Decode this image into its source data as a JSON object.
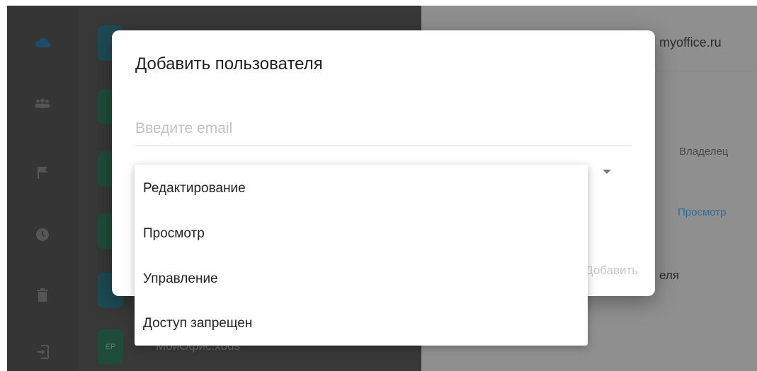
{
  "dialog": {
    "title": "Добавить пользователя",
    "email_placeholder": "Введите email",
    "add_label": "Добавить"
  },
  "permission_menu": {
    "items": [
      {
        "label": "Редактирование"
      },
      {
        "label": "Просмотр"
      },
      {
        "label": "Управление"
      },
      {
        "label": "Доступ запрещен"
      }
    ]
  },
  "info_pane": {
    "email_partial": "myoffice.ru",
    "owner_role": "Владелец",
    "view_role": "Просмотр",
    "trailing_text": "еля"
  },
  "file_list": {
    "last_item_name": "МойОфис.xods",
    "last_item_badge": "ЕР"
  },
  "colors": {
    "accent": "#2f6f96",
    "thumb_dark_green": "#1f4c3a",
    "thumb_teal": "#1d4b55"
  },
  "icons": [
    "cloud-icon",
    "people-icon",
    "flag-icon",
    "clock-icon",
    "trash-icon",
    "logout-icon"
  ]
}
